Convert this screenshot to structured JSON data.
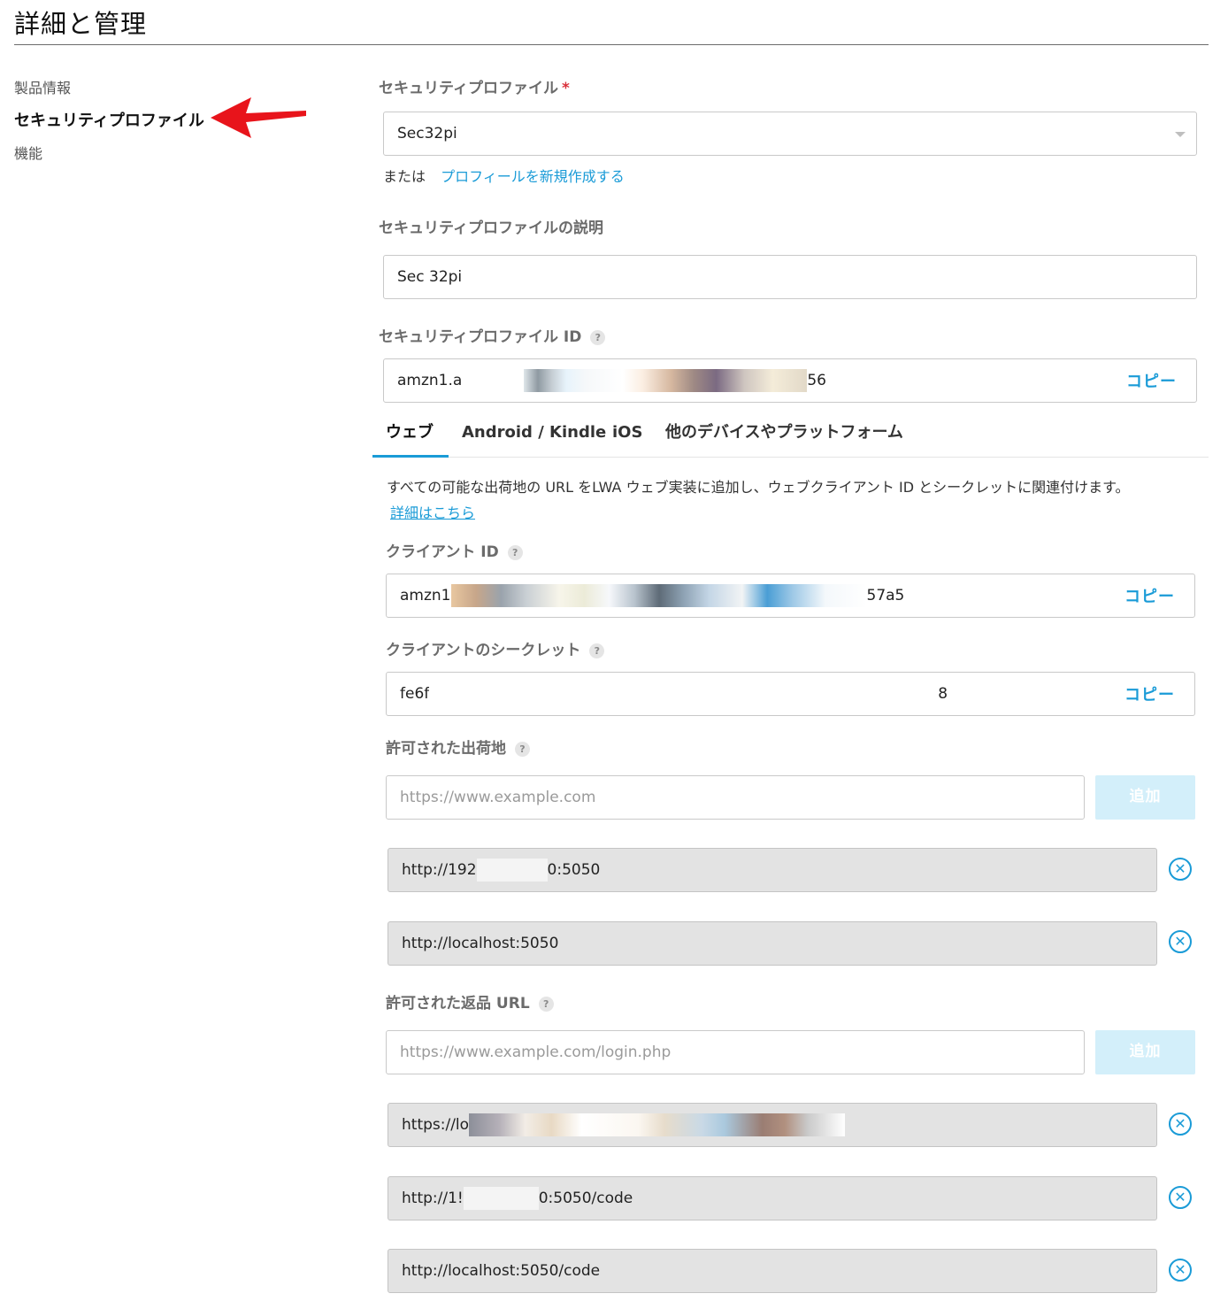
{
  "page": {
    "title": "詳細と管理"
  },
  "sidebar": {
    "items": [
      {
        "label": "製品情報"
      },
      {
        "label": "セキュリティプロファイル"
      },
      {
        "label": "機能"
      }
    ]
  },
  "security_profile": {
    "label": "セキュリティプロファイル",
    "required_mark": "*",
    "selected": "Sec32pi",
    "or_text": "または",
    "create_link": "プロフィールを新規作成する"
  },
  "description": {
    "label": "セキュリティプロファイルの説明",
    "value": "Sec 32pi"
  },
  "profile_id": {
    "label": "セキュリティプロファイル ID",
    "value_start": "amzn1.a",
    "value_end": "56",
    "copy_label": "コピー"
  },
  "help_icon": "?",
  "tabs": [
    {
      "label": "ウェブ"
    },
    {
      "label": "Android / Kindle"
    },
    {
      "label": "iOS"
    },
    {
      "label": "他のデバイスやプラットフォーム"
    }
  ],
  "web": {
    "description": "すべての可能な出荷地の URL をLWA ウェブ実装に追加し、ウェブクライアント ID とシークレットに関連付けます。",
    "learn_more": "詳細はこちら",
    "client_id": {
      "label": "クライアント ID",
      "value_start": "amzn1",
      "value_end": "57a5",
      "copy_label": "コピー"
    },
    "client_secret": {
      "label": "クライアントのシークレット",
      "value_start": "fe6f",
      "value_end": "8",
      "copy_label": "コピー"
    },
    "origins": {
      "label": "許可された出荷地",
      "placeholder": "https://www.example.com",
      "add_label": "追加",
      "entries": [
        {
          "start": "http://192",
          "end": "0:5050"
        },
        {
          "start": "http://localhost:5050",
          "end": ""
        }
      ]
    },
    "return_urls": {
      "label": "許可された返品 URL",
      "placeholder": "https://www.example.com/login.php",
      "add_label": "追加",
      "entries": [
        {
          "start": "https://lo",
          "end": ""
        },
        {
          "start": "http://1!",
          "end": "0:5050/code"
        },
        {
          "start": "http://localhost:5050/code",
          "end": ""
        }
      ]
    }
  },
  "remove_icon": "✕",
  "colors": {
    "accent": "#1a9bd7",
    "arrow": "#e8141b",
    "disabled_button": "#d3effa"
  }
}
